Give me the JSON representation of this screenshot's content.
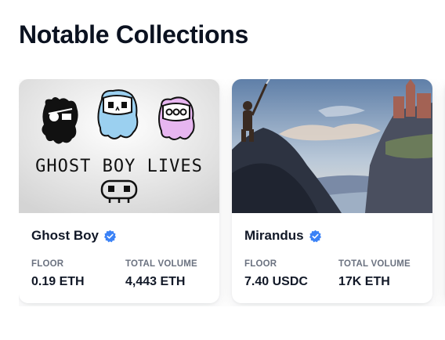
{
  "section": {
    "title": "Notable Collections"
  },
  "collections": [
    {
      "name": "Ghost Boy",
      "verified": true,
      "image_text": "GHOST BOY LIVES",
      "floor_label": "FLOOR",
      "floor_value": "0.19 ETH",
      "volume_label": "TOTAL VOLUME",
      "volume_value": "4,443 ETH"
    },
    {
      "name": "Mirandus",
      "verified": true,
      "floor_label": "FLOOR",
      "floor_value": "7.40 USDC",
      "volume_label": "TOTAL VOLUME",
      "volume_value": "17K ETH"
    }
  ],
  "colors": {
    "verified": "#3b82f6",
    "label": "#6b7280",
    "title": "#0b1220"
  }
}
